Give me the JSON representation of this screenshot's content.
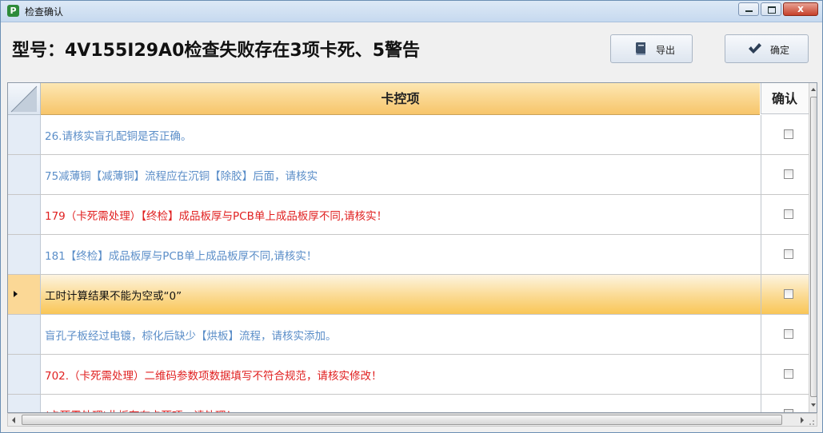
{
  "window": {
    "title": "检查确认",
    "app_icon": "P",
    "close_glyph": "x"
  },
  "header": {
    "title": "型号：4V155I29A0检查失败存在3项卡死、5警告",
    "export_label": "导出",
    "confirm_label": "确定"
  },
  "grid": {
    "columns": {
      "main": "卡控项",
      "confirm": "确认"
    },
    "rows": [
      {
        "text": "26.请核实盲孔配铜是否正确。",
        "color": "#5b8ec8",
        "checked": false,
        "selected": false
      },
      {
        "text": "75减薄铜【减薄铜】流程应在沉铜【除胶】后面，请核实",
        "color": "#5b8ec8",
        "checked": false,
        "selected": false
      },
      {
        "text": "179（卡死需处理）【终检】成品板厚与PCB单上成品板厚不同,请核实！",
        "color": "#e02020",
        "checked": false,
        "selected": false
      },
      {
        "text": "181【终检】成品板厚与PCB单上成品板厚不同,请核实！",
        "color": "#5b8ec8",
        "checked": false,
        "selected": false
      },
      {
        "text": "工时计算结果不能为空或“0”",
        "color": "#111111",
        "checked": false,
        "selected": true
      },
      {
        "text": "盲孔子板经过电镀，棕化后缺少【烘板】流程，请核实添加。",
        "color": "#5b8ec8",
        "checked": false,
        "selected": false
      },
      {
        "text": "702.（卡死需处理）二维码参数项数据填写不符合规范，请核实修改！",
        "color": "#e02020",
        "checked": false,
        "selected": false
      },
      {
        "text": "(卡死需处理)此板存在卡死项，请处理！",
        "color": "#e02020",
        "checked": false,
        "selected": false
      }
    ]
  }
}
